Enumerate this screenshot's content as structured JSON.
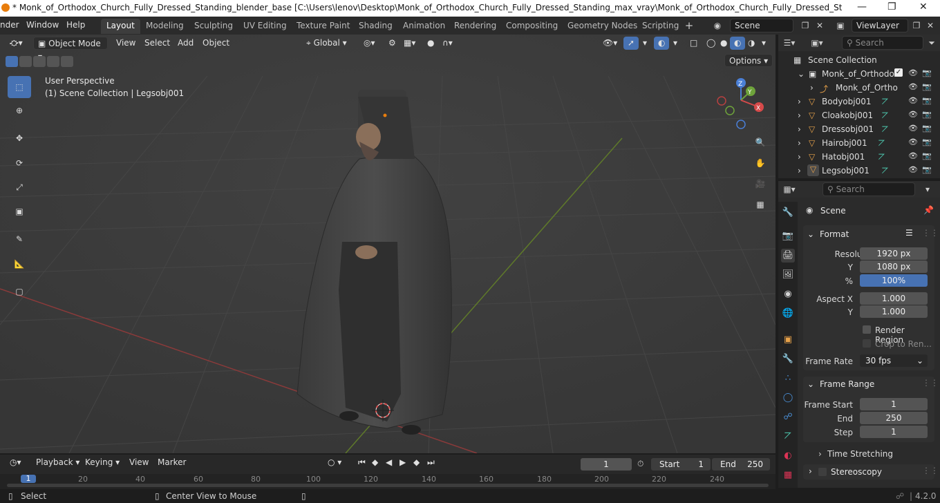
{
  "titlebar": {
    "title": "* Monk_of_Orthodox_Church_Fully_Dressed_Standing_blender_base [C:\\Users\\lenov\\Desktop\\Monk_of_Orthodox_Church_Fully_Dressed_Standing_max_vray\\Monk_of_Orthodox_Church_Fully_Dressed_Standing_blender_base...."
  },
  "menu": [
    "nder",
    "Window",
    "Help"
  ],
  "workspaces": [
    "Layout",
    "Modeling",
    "Sculpting",
    "UV Editing",
    "Texture Paint",
    "Shading",
    "Animation",
    "Rendering",
    "Compositing",
    "Geometry Nodes",
    "Scripting"
  ],
  "active_workspace": "Layout",
  "scene_name": "Scene",
  "view_layer": "ViewLayer",
  "viewport": {
    "mode": "Object Mode",
    "menus": [
      "View",
      "Select",
      "Add",
      "Object"
    ],
    "orientation": "Global",
    "options": "Options",
    "perspective_label": "User Perspective",
    "collection_label": "(1) Scene Collection | Legsobj001"
  },
  "gizmo": {
    "z": "Z",
    "y": "Y",
    "x": "X"
  },
  "outliner": {
    "search_placeholder": "Search",
    "root": "Scene Collection",
    "items": [
      {
        "name": "Monk_of_Orthodox",
        "type": "collection"
      },
      {
        "name": "Monk_of_Ortho",
        "type": "armature"
      },
      {
        "name": "Bodyobj001",
        "type": "mesh"
      },
      {
        "name": "Cloakobj001",
        "type": "mesh"
      },
      {
        "name": "Dressobj001",
        "type": "mesh"
      },
      {
        "name": "Hairobj001",
        "type": "mesh"
      },
      {
        "name": "Hatobj001",
        "type": "mesh"
      },
      {
        "name": "Legsobj001",
        "type": "mesh"
      }
    ]
  },
  "properties": {
    "search_placeholder": "Search",
    "context": "Scene",
    "format": {
      "title": "Format",
      "res_x_label": "Resolutio...",
      "res_x": "1920 px",
      "res_y_label": "Y",
      "res_y": "1080 px",
      "pct_label": "%",
      "pct": "100%",
      "aspect_x_label": "Aspect X",
      "aspect_x": "1.000",
      "aspect_y_label": "Y",
      "aspect_y": "1.000",
      "render_region": "Render Region",
      "crop": "Crop to Ren...",
      "frame_rate_label": "Frame Rate",
      "frame_rate": "30 fps"
    },
    "frame_range": {
      "title": "Frame Range",
      "start_label": "Frame Start",
      "start": "1",
      "end_label": "End",
      "end": "250",
      "step_label": "Step",
      "step": "1"
    },
    "time_stretching": "Time Stretching",
    "stereoscopy": "Stereoscopy"
  },
  "timeline": {
    "menus": [
      "Playback",
      "Keying",
      "View",
      "Marker"
    ],
    "current_frame": "1",
    "start_label": "Start",
    "start": "1",
    "end_label": "End",
    "end": "250",
    "ticks": [
      "1",
      "20",
      "40",
      "60",
      "80",
      "100",
      "120",
      "140",
      "160",
      "180",
      "200",
      "220",
      "240"
    ]
  },
  "statusbar": {
    "select": "Select",
    "center": "Center View to Mouse",
    "version": "4.2.0"
  },
  "colors": {
    "accent": "#4772b3",
    "orange": "#e87d0d",
    "mesh": "#4ec9b0"
  }
}
